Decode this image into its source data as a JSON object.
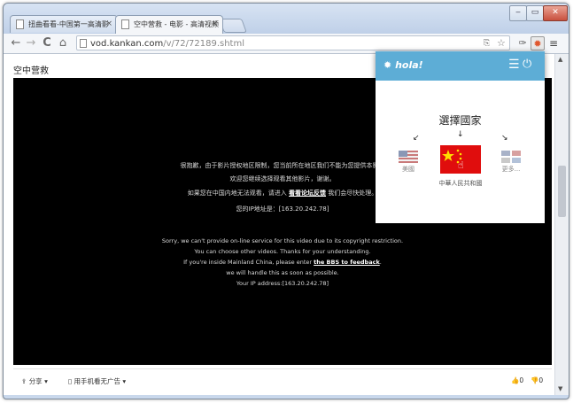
{
  "browser": {
    "tabs": [
      {
        "label": "扭曲看看-中国第一高清影",
        "active": false
      },
      {
        "label": "空中营救 - 电影 - 高清视频",
        "active": true
      }
    ],
    "url_host": "vod.kankan.com",
    "url_path": "/v/72/72189.shtml"
  },
  "page": {
    "title": "空中营救",
    "notice_cn": [
      "很抱歉，由于影片授权地区限制，您当前所在地区我们不能为您提供本影片",
      "欢迎您继续选择观看其他影片，谢谢。",
      "如果您在中国内地无法观看，请进入",
      "我们会尽快处理。",
      "您的IP地址是：[163.20.242.78]"
    ],
    "notice_cn_link": "看看论坛反馈",
    "notice_en": [
      "Sorry, we can't provide on-line service for this video due to its copyright restriction.",
      "You can choose other videos. Thanks for your understanding.",
      "If you're inside Mainland China, please enter",
      "we will handle this as soon as possible.",
      "Your IP address:[163.20.242.78]"
    ],
    "notice_en_link": "the BBS to feedback",
    "notice_en_period": ".",
    "share_label": "分享",
    "mobile_label": "用手机看无广告",
    "like_count": "0",
    "dislike_count": "0"
  },
  "hola": {
    "logo": "hola!",
    "title": "選擇國家",
    "countries": [
      {
        "label": "美國"
      },
      {
        "label": "中華人民共和國"
      },
      {
        "label": "更多..."
      }
    ]
  }
}
